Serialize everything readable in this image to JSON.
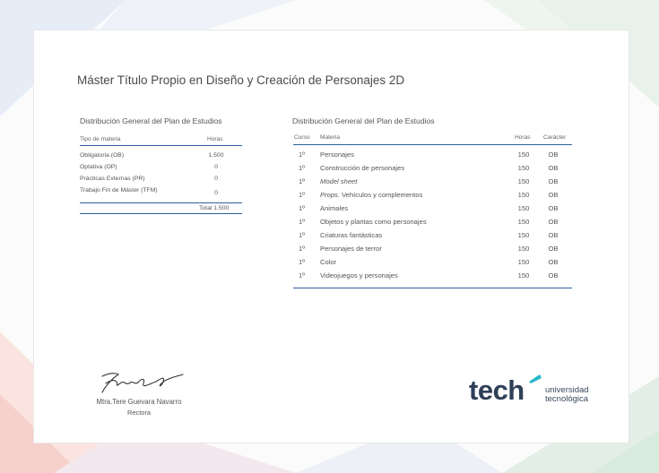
{
  "title": "Máster Título Propio en Diseño y Creación de Personajes 2D",
  "left_table": {
    "heading": "Distribución General del Plan de Estudios",
    "col_type": "Tipo de materia",
    "col_hours": "Horas",
    "rows": [
      {
        "type": "Obligatoria (OB)",
        "hours": "1.500"
      },
      {
        "type": "Optativa (OP)",
        "hours": "0"
      },
      {
        "type": "Prácticas Externas (PR)",
        "hours": "0"
      },
      {
        "type": "Trabajo Fin de Máster (TFM)",
        "hours": "0"
      }
    ],
    "total": "Total 1.500"
  },
  "right_table": {
    "heading": "Distribución General del Plan de Estudios",
    "col_course": "Curso",
    "col_subject": "Materia",
    "col_hours": "Horas",
    "col_char": "Carácter",
    "rows": [
      {
        "course": "1º",
        "subject": "Personajes",
        "hours": "150",
        "char": "OB"
      },
      {
        "course": "1º",
        "subject": "Construcción de personajes",
        "hours": "150",
        "char": "OB"
      },
      {
        "course": "1º",
        "subject": "Model sheet",
        "hours": "150",
        "char": "OB"
      },
      {
        "course": "1º",
        "subject_italic": "Props.",
        "subject": "Vehículos y complementos",
        "hours": "150",
        "char": "OB"
      },
      {
        "course": "1º",
        "subject": "Animales",
        "hours": "150",
        "char": "OB"
      },
      {
        "course": "1º",
        "subject": "Objetos y plantas como personajes",
        "hours": "150",
        "char": "OB"
      },
      {
        "course": "1º",
        "subject": "Criaturas fantásticas",
        "hours": "150",
        "char": "OB"
      },
      {
        "course": "1º",
        "subject": "Personajes de terror",
        "hours": "150",
        "char": "OB"
      },
      {
        "course": "1º",
        "subject": "Color",
        "hours": "150",
        "char": "OB"
      },
      {
        "course": "1º",
        "subject": "Videojuegos y personajes",
        "hours": "150",
        "char": "OB"
      }
    ]
  },
  "signature": {
    "name": "Mtra.Tere Guevara Navarro",
    "role": "Rectora"
  },
  "logo": {
    "word": "tech",
    "line1": "universidad",
    "line2": "tecnológica"
  }
}
